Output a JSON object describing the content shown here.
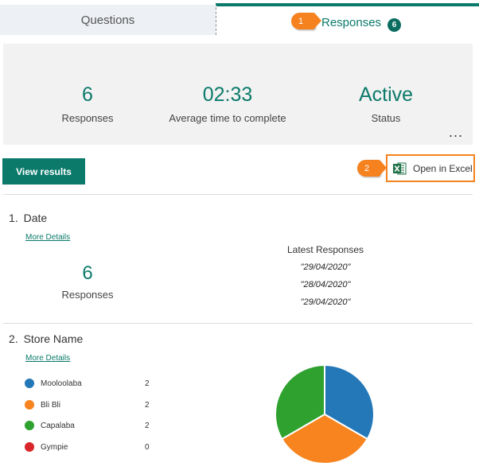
{
  "tabs": {
    "questions_label": "Questions",
    "responses_label": "Responses",
    "responses_count": "6"
  },
  "callouts": {
    "one": "1",
    "two": "2"
  },
  "summary": {
    "responses_value": "6",
    "responses_caption": "Responses",
    "time_value": "02:33",
    "time_caption": "Average time to complete",
    "status_value": "Active",
    "status_caption": "Status",
    "more_glyph": "..."
  },
  "actions": {
    "view_results": "View results",
    "open_excel": "Open in Excel"
  },
  "questions": [
    {
      "number": "1.",
      "title": "Date",
      "more_details": "More Details",
      "count_value": "6",
      "count_caption": "Responses",
      "latest_heading": "Latest Responses",
      "latest": [
        "\"29/04/2020\"",
        "\"28/04/2020\"",
        "\"29/04/2020\""
      ]
    },
    {
      "number": "2.",
      "title": "Store Name",
      "more_details": "More Details",
      "options": [
        {
          "label": "Mooloolaba",
          "count": "2",
          "color": "#2478b8"
        },
        {
          "label": "Bli Bli",
          "count": "2",
          "color": "#f7841e"
        },
        {
          "label": "Capalaba",
          "count": "2",
          "color": "#2ea12f"
        },
        {
          "label": "Gympie",
          "count": "0",
          "color": "#d8262a"
        }
      ]
    }
  ],
  "chart_data": {
    "type": "pie",
    "categories": [
      "Mooloolaba",
      "Bli Bli",
      "Capalaba",
      "Gympie"
    ],
    "values": [
      2,
      2,
      2,
      0
    ],
    "colors": [
      "#2478b8",
      "#f7841e",
      "#2ea12f",
      "#d8262a"
    ]
  },
  "colors": {
    "accent": "#0b7a6b",
    "callout": "#f5821f",
    "excel": "#1e7145"
  },
  "icons": {
    "excel": "excel-icon",
    "more": "more-icon"
  }
}
